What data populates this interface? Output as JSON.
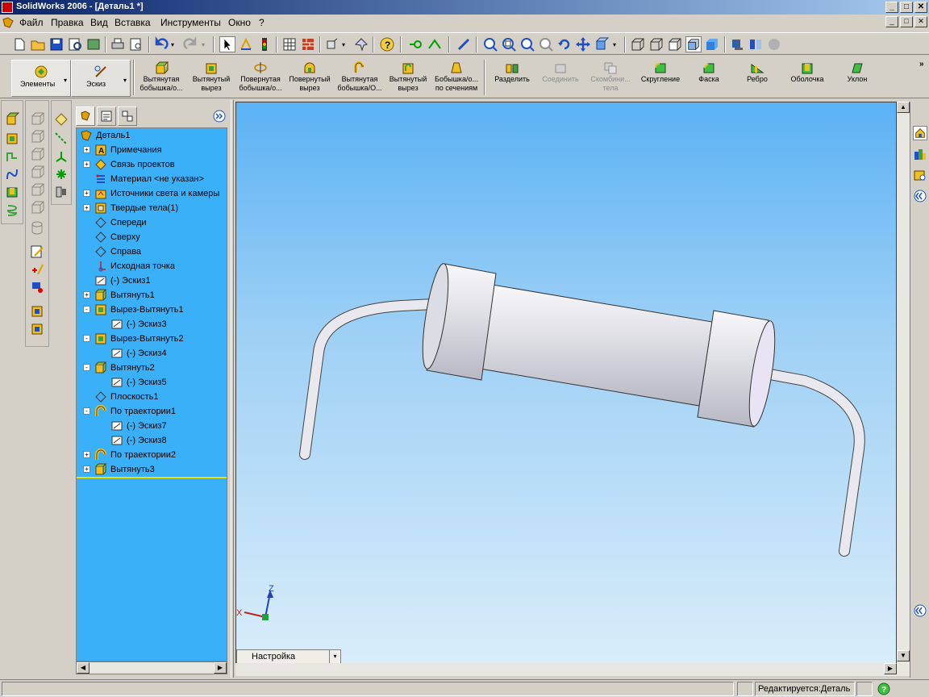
{
  "titlebar": {
    "title": "SolidWorks 2006 - [Деталь1 *]",
    "min": "_",
    "max": "□",
    "close": "✕"
  },
  "menubar": {
    "items": [
      "Файл",
      "Правка",
      "Вид",
      "Вставка",
      "Инструменты",
      "Окно",
      "?"
    ]
  },
  "commandmanager": {
    "features_label": "Элементы",
    "sketch_label": "Эскиз",
    "buttons": [
      {
        "line1": "Вытянутая",
        "line2": "бобышка/о..."
      },
      {
        "line1": "Вытянутый",
        "line2": "вырез"
      },
      {
        "line1": "Повернутая",
        "line2": "бобышка/о..."
      },
      {
        "line1": "Повернутый",
        "line2": "вырез"
      },
      {
        "line1": "Вытянутая",
        "line2": "бобышка/О..."
      },
      {
        "line1": "Вытянутый",
        "line2": "вырез"
      },
      {
        "line1": "Бобышка/о...",
        "line2": "по сечениям"
      },
      {
        "line1": "Разделить",
        "line2": ""
      },
      {
        "line1": "Соединить",
        "line2": ""
      },
      {
        "line1": "Скомбини...",
        "line2": "тела"
      },
      {
        "line1": "Скругление",
        "line2": ""
      },
      {
        "line1": "Фаска",
        "line2": ""
      },
      {
        "line1": "Ребро",
        "line2": ""
      },
      {
        "line1": "Оболочка",
        "line2": ""
      },
      {
        "line1": "Уклон",
        "line2": ""
      }
    ]
  },
  "tree": {
    "root": "Деталь1",
    "items": [
      {
        "label": "Примечания",
        "icon": "annotations-icon",
        "expand": "+"
      },
      {
        "label": "Связь проектов",
        "icon": "design-binder-icon",
        "expand": "+"
      },
      {
        "label": "Материал <не указан>",
        "icon": "material-icon",
        "expand": ""
      },
      {
        "label": "Источники света и камеры",
        "icon": "lights-icon",
        "expand": "+"
      },
      {
        "label": "Твердые тела(1)",
        "icon": "solid-bodies-icon",
        "expand": "+"
      },
      {
        "label": "Спереди",
        "icon": "plane-icon",
        "expand": ""
      },
      {
        "label": "Сверху",
        "icon": "plane-icon",
        "expand": ""
      },
      {
        "label": "Справа",
        "icon": "plane-icon",
        "expand": ""
      },
      {
        "label": "Исходная точка",
        "icon": "origin-icon",
        "expand": ""
      },
      {
        "label": "(-) Эскиз1",
        "icon": "sketch-icon",
        "expand": ""
      },
      {
        "label": "Вытянуть1",
        "icon": "extrude-icon",
        "expand": "+"
      },
      {
        "label": "Вырез-Вытянуть1",
        "icon": "cut-extrude-icon",
        "expand": "-"
      },
      {
        "label": "(-) Эскиз3",
        "icon": "sketch-icon",
        "expand": "",
        "child": true
      },
      {
        "label": "Вырез-Вытянуть2",
        "icon": "cut-extrude-icon",
        "expand": "-"
      },
      {
        "label": "(-) Эскиз4",
        "icon": "sketch-icon",
        "expand": "",
        "child": true
      },
      {
        "label": "Вытянуть2",
        "icon": "extrude-icon",
        "expand": "-"
      },
      {
        "label": "(-) Эскиз5",
        "icon": "sketch-icon",
        "expand": "",
        "child": true
      },
      {
        "label": "Плоскость1",
        "icon": "plane-icon",
        "expand": ""
      },
      {
        "label": "По траектории1",
        "icon": "sweep-icon",
        "expand": "-"
      },
      {
        "label": "(-) Эскиз7",
        "icon": "sketch-icon",
        "expand": "",
        "child": true
      },
      {
        "label": "(-) Эскиз8",
        "icon": "sketch-icon",
        "expand": "",
        "child": true
      },
      {
        "label": "По траектории2",
        "icon": "sweep-icon",
        "expand": "+"
      },
      {
        "label": "Вытянуть3",
        "icon": "extrude-icon",
        "expand": "+"
      }
    ]
  },
  "viewport": {
    "configuration": "Настройка",
    "triad_z": "Z",
    "triad_x": "X"
  },
  "statusbar": {
    "editing": "Редактируется:Деталь"
  },
  "colors": {
    "tree_bg": "#3ab0f8",
    "viewport_top": "#5ab2f5",
    "viewport_bottom": "#dbeefa",
    "title_blue": "#0a246a"
  }
}
